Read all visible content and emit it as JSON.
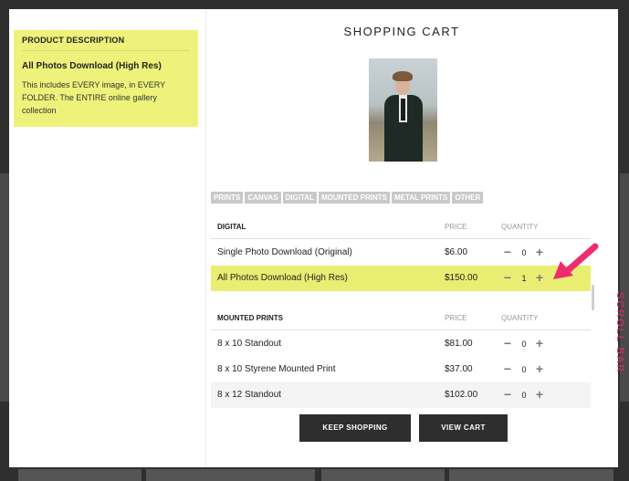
{
  "product_description": {
    "header": "PRODUCT DESCRIPTION",
    "name": "All Photos Download (High Res)",
    "text": "This includes EVERY image, in EVERY FOLDER. The ENTIRE online gallery collection"
  },
  "cart": {
    "title": "SHOPPING CART",
    "tabs": [
      "PRINTS",
      "CANVAS",
      "DIGITAL",
      "MOUNTED PRINTS",
      "METAL PRINTS",
      "OTHER"
    ],
    "digital": {
      "header": "DIGITAL",
      "price_label": "PRICE",
      "quantity_label": "QUANTITY",
      "items": [
        {
          "name": "Single Photo Download (Original)",
          "price": "$6.00",
          "quantity": "0"
        },
        {
          "name": "All Photos Download (High Res)",
          "price": "$150.00",
          "quantity": "1"
        }
      ]
    },
    "mounted": {
      "header": "MOUNTED PRINTS",
      "price_label": "PRICE",
      "quantity_label": "QUANTITY",
      "items": [
        {
          "name": "8 x 10 Standout",
          "price": "$81.00",
          "quantity": "0"
        },
        {
          "name": "8 x 10 Styrene Mounted Print",
          "price": "$37.00",
          "quantity": "0"
        },
        {
          "name": "8 x 12 Standout",
          "price": "$102.00",
          "quantity": "0"
        }
      ]
    }
  },
  "annotation": {
    "scroll_bar": "SCROLL BAR"
  },
  "buttons": {
    "keep_shopping": "KEEP SHOPPING",
    "view_cart": "VIEW CART"
  },
  "icons": {
    "minus": "minus-icon",
    "plus": "plus-icon"
  },
  "colors": {
    "highlight": "#e9ee72",
    "annotation": "#ee2b6e",
    "button": "#2e2e2e"
  }
}
